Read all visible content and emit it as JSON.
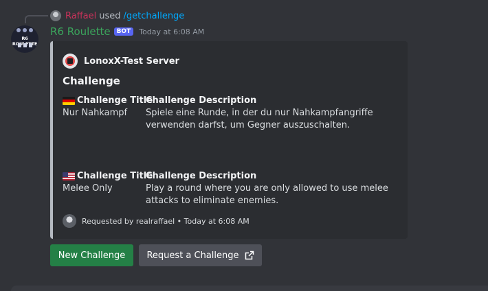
{
  "reply": {
    "username": "Raffael",
    "used": "used",
    "command": "/getchallenge"
  },
  "message": {
    "bot_name": "R6 Roulette",
    "bot_tag": "BOT",
    "timestamp": "Today at 6:08 AM",
    "avatar_word": "R6 ROULETTE"
  },
  "embed": {
    "author": "LonoxX-Test Server",
    "title": "Challenge",
    "fields": [
      {
        "flag": "flag-germany-icon",
        "name": "Challenge Title",
        "value": "Nur Nahkampf"
      },
      {
        "name": "Challenge Description",
        "value": "Spiele eine Runde, in der du nur Nahkampfangriffe verwenden darfst, um Gegner auszuschalten."
      },
      {
        "flag": "flag-usa-icon",
        "name": "Challenge Title",
        "value": "Melee Only"
      },
      {
        "name": "Challenge Description",
        "value": "Play a round where you are only allowed to use melee attacks to eliminate enemies."
      }
    ],
    "footer": "Requested by realraffael • Today at 6:08 AM",
    "accent_color": "#b5bac1"
  },
  "buttons": {
    "new_challenge": "New Challenge",
    "request_challenge": "Request a Challenge",
    "request_icon": "external-link-icon"
  },
  "colors": {
    "background": "#313338",
    "embed_background": "#2b2d31",
    "bot_name": "#3ba55c",
    "bot_tag": "#5865f2",
    "command": "#00a8fc",
    "success_button": "#248046",
    "secondary_button": "#4e5058"
  }
}
